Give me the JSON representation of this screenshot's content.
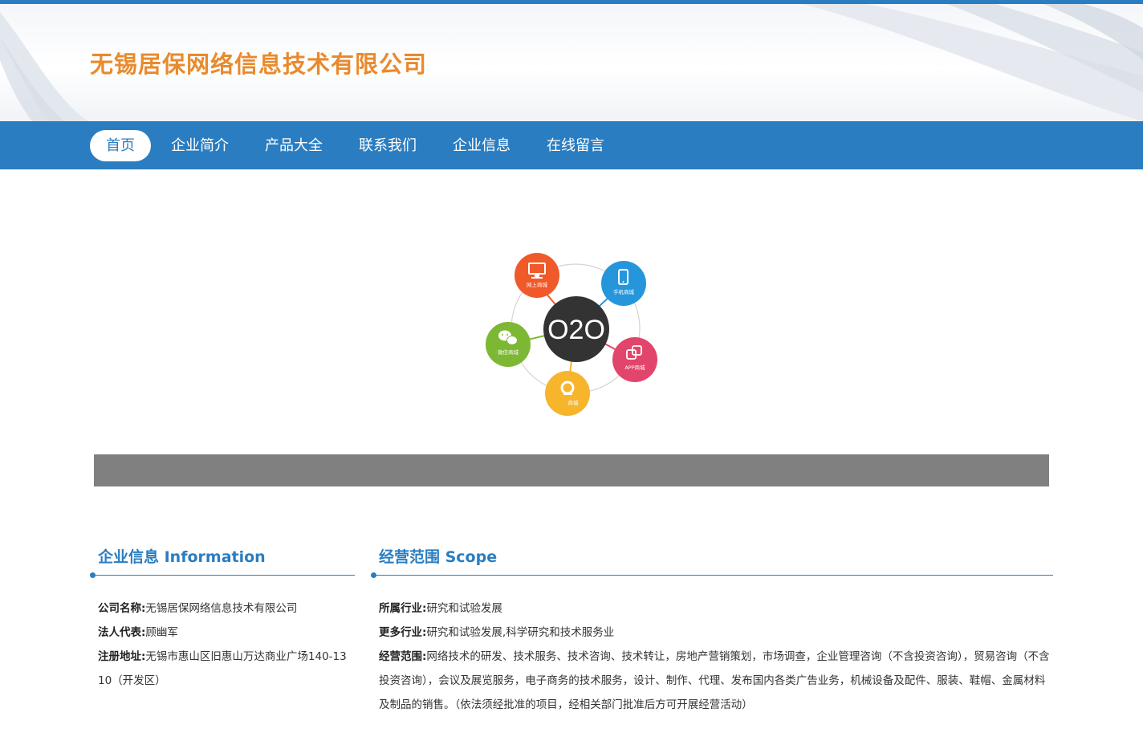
{
  "site": {
    "title": "无锡居保网络信息技术有限公司"
  },
  "nav": {
    "items": [
      {
        "label": "首页",
        "active": true
      },
      {
        "label": "企业简介"
      },
      {
        "label": "产品大全"
      },
      {
        "label": "联系我们"
      },
      {
        "label": "企业信息"
      },
      {
        "label": "在线留言"
      }
    ]
  },
  "banner": {
    "center_label": "O2O",
    "nodes": [
      {
        "label": "网上商城",
        "icon": "monitor-icon",
        "color": "#f0592a"
      },
      {
        "label": "手机商城",
        "icon": "phone-icon",
        "color": "#2596dc"
      },
      {
        "label": "APP商城",
        "icon": "app-icon",
        "color": "#e2456b"
      },
      {
        "label": "商城",
        "icon": "q-icon",
        "color": "#f7b52c"
      },
      {
        "label": "微信商城",
        "icon": "wechat-icon",
        "color": "#7cb833"
      }
    ]
  },
  "info": {
    "title": "企业信息 Information",
    "company_name_label": "公司名称:",
    "company_name": "无锡居保网络信息技术有限公司",
    "legal_rep_label": "法人代表:",
    "legal_rep": "顾幽军",
    "address_label": "注册地址:",
    "address": "无锡市惠山区旧惠山万达商业广场140-1310（开发区）"
  },
  "scope": {
    "title": "经营范围 Scope",
    "industry_label": "所属行业:",
    "industry": "研究和试验发展",
    "more_label": "更多行业:",
    "more": "研究和试验发展,科学研究和技术服务业",
    "scope_label": "经营范围:",
    "scope": "网络技术的研发、技术服务、技术咨询、技术转让，房地产营销策划，市场调查，企业管理咨询（不含投资咨询），贸易咨询（不含投资咨询），会议及展览服务，电子商务的技术服务，设计、制作、代理、发布国内各类广告业务，机械设备及配件、服装、鞋帽、金属材料及制品的销售。（依法须经批准的项目，经相关部门批准后方可开展经营活动）"
  },
  "colors": {
    "primary": "#2a7dc0",
    "title_orange": "#e98a2d",
    "gray_bar": "#808080"
  }
}
